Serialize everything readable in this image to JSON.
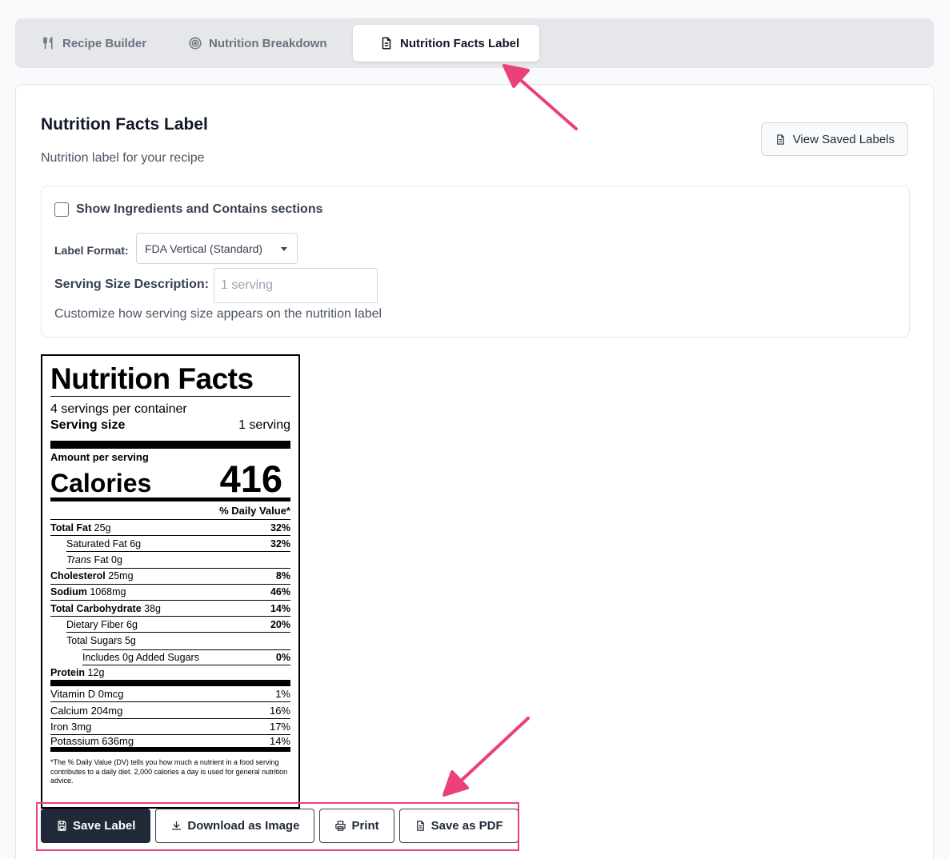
{
  "tabs": [
    {
      "label": "Recipe Builder",
      "icon": "utensils-icon",
      "active": false
    },
    {
      "label": "Nutrition Breakdown",
      "icon": "target-icon",
      "active": false
    },
    {
      "label": "Nutrition Facts Label",
      "icon": "document-icon",
      "active": true
    }
  ],
  "header": {
    "title": "Nutrition Facts Label",
    "subtitle": "Nutrition label for your recipe",
    "view_saved_label": "View Saved Labels"
  },
  "settings": {
    "show_sections_label": "Show Ingredients and Contains sections",
    "show_sections_checked": false,
    "format_label": "Label Format:",
    "format_value": "FDA Vertical (Standard)",
    "serving_label": "Serving Size Description:",
    "serving_placeholder": "1 serving",
    "serving_help": "Customize how serving size appears on the nutrition label"
  },
  "label": {
    "title": "Nutrition Facts",
    "servings": "4 servings per container",
    "serving_size_label": "Serving size",
    "serving_size_value": "1 serving",
    "amount_per": "Amount per serving",
    "calories_label": "Calories",
    "calories_value": "416",
    "dv_header": "% Daily Value*",
    "total_fat": {
      "name": "Total Fat",
      "amt": "25g",
      "pct": "32%"
    },
    "sat_fat": {
      "name": "Saturated Fat 6g",
      "pct": "32%"
    },
    "trans_fat": {
      "name": "Trans",
      "amt": "Fat 0g"
    },
    "cholesterol": {
      "name": "Cholesterol",
      "amt": "25mg",
      "pct": "8%"
    },
    "sodium": {
      "name": "Sodium",
      "amt": "1068mg",
      "pct": "46%"
    },
    "carbs": {
      "name": "Total Carbohydrate",
      "amt": "38g",
      "pct": "14%"
    },
    "fiber": {
      "name": "Dietary Fiber 6g",
      "pct": "20%"
    },
    "sugars": {
      "name": "Total Sugars 5g"
    },
    "added_sugars": {
      "name": "Includes 0g Added Sugars",
      "pct": "0%"
    },
    "protein": {
      "name": "Protein",
      "amt": "12g"
    },
    "vitamins": [
      {
        "name": "Vitamin D 0mcg",
        "pct": "1%"
      },
      {
        "name": "Calcium 204mg",
        "pct": "16%"
      },
      {
        "name": "Iron 3mg",
        "pct": "17%"
      },
      {
        "name": "Potassium 636mg",
        "pct": "14%"
      }
    ],
    "footnote": "*The % Daily Value (DV) tells you how much a nutrient in a food serving contributes to a daily diet. 2,000 calories a day is used for general nutrition advice."
  },
  "actions": {
    "save": "Save Label",
    "download": "Download as Image",
    "print": "Print",
    "pdf": "Save as PDF"
  },
  "colors": {
    "accent": "#ec407a",
    "primary_button": "#1f2937"
  }
}
